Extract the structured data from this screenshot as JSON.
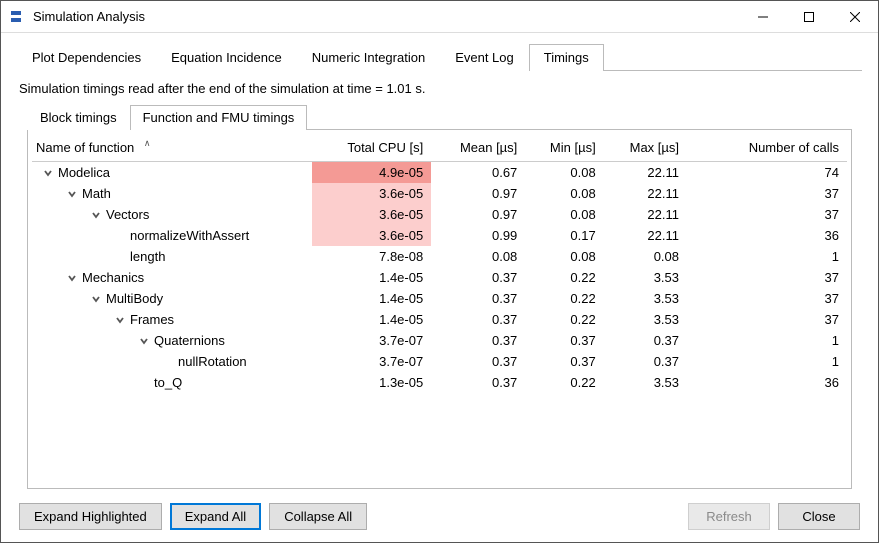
{
  "window": {
    "title": "Simulation Analysis"
  },
  "tabs_outer": [
    {
      "label": "Plot Dependencies",
      "active": false
    },
    {
      "label": "Equation Incidence",
      "active": false
    },
    {
      "label": "Numeric Integration",
      "active": false
    },
    {
      "label": "Event Log",
      "active": false
    },
    {
      "label": "Timings",
      "active": true
    }
  ],
  "status_line": "Simulation timings read after the end of the simulation at time = 1.01 s.",
  "tabs_inner": [
    {
      "label": "Block timings",
      "active": false
    },
    {
      "label": "Function and FMU timings",
      "active": true
    }
  ],
  "columns": [
    {
      "label": "Name of function",
      "align": "left",
      "sort": "asc"
    },
    {
      "label": "Total CPU [s]",
      "align": "right"
    },
    {
      "label": "Mean [µs]",
      "align": "right"
    },
    {
      "label": "Min [µs]",
      "align": "right"
    },
    {
      "label": "Max [µs]",
      "align": "right"
    },
    {
      "label": "Number of calls",
      "align": "right"
    }
  ],
  "rows": [
    {
      "name": "Modelica",
      "indent": 0,
      "expandable": true,
      "total": "4.9e-05",
      "mean": "0.67",
      "min": "0.08",
      "max": "22.11",
      "calls": "74",
      "heat": 1
    },
    {
      "name": "Math",
      "indent": 1,
      "expandable": true,
      "total": "3.6e-05",
      "mean": "0.97",
      "min": "0.08",
      "max": "22.11",
      "calls": "37",
      "heat": 2
    },
    {
      "name": "Vectors",
      "indent": 2,
      "expandable": true,
      "total": "3.6e-05",
      "mean": "0.97",
      "min": "0.08",
      "max": "22.11",
      "calls": "37",
      "heat": 2
    },
    {
      "name": "normalizeWithAssert",
      "indent": 3,
      "expandable": false,
      "total": "3.6e-05",
      "mean": "0.99",
      "min": "0.17",
      "max": "22.11",
      "calls": "36",
      "heat": 2
    },
    {
      "name": "length",
      "indent": 3,
      "expandable": false,
      "total": "7.8e-08",
      "mean": "0.08",
      "min": "0.08",
      "max": "0.08",
      "calls": "1",
      "heat": 0
    },
    {
      "name": "Mechanics",
      "indent": 1,
      "expandable": true,
      "total": "1.4e-05",
      "mean": "0.37",
      "min": "0.22",
      "max": "3.53",
      "calls": "37",
      "heat": 0
    },
    {
      "name": "MultiBody",
      "indent": 2,
      "expandable": true,
      "total": "1.4e-05",
      "mean": "0.37",
      "min": "0.22",
      "max": "3.53",
      "calls": "37",
      "heat": 0
    },
    {
      "name": "Frames",
      "indent": 3,
      "expandable": true,
      "total": "1.4e-05",
      "mean": "0.37",
      "min": "0.22",
      "max": "3.53",
      "calls": "37",
      "heat": 0
    },
    {
      "name": "Quaternions",
      "indent": 4,
      "expandable": true,
      "total": "3.7e-07",
      "mean": "0.37",
      "min": "0.37",
      "max": "0.37",
      "calls": "1",
      "heat": 0
    },
    {
      "name": "nullRotation",
      "indent": 5,
      "expandable": false,
      "total": "3.7e-07",
      "mean": "0.37",
      "min": "0.37",
      "max": "0.37",
      "calls": "1",
      "heat": 0
    },
    {
      "name": "to_Q",
      "indent": 4,
      "expandable": false,
      "total": "1.3e-05",
      "mean": "0.37",
      "min": "0.22",
      "max": "3.53",
      "calls": "36",
      "heat": 0
    }
  ],
  "buttons": {
    "expand_highlighted": "Expand Highlighted",
    "expand_all": "Expand All",
    "collapse_all": "Collapse All",
    "refresh": "Refresh",
    "close": "Close"
  }
}
